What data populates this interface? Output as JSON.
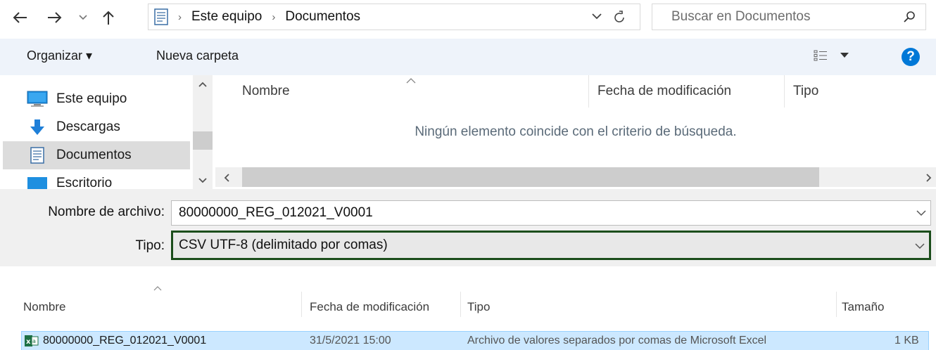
{
  "address_bar": {
    "breadcrumb": [
      "Este equipo",
      "Documentos"
    ],
    "search_placeholder": "Buscar en Documentos"
  },
  "command_bar": {
    "organize_label": "Organizar ▾",
    "new_folder_label": "Nueva carpeta",
    "help_label": "?"
  },
  "nav_pane": {
    "items": [
      {
        "label": "Este equipo",
        "icon": "computer-icon"
      },
      {
        "label": "Descargas",
        "icon": "download-arrow-icon"
      },
      {
        "label": "Documentos",
        "icon": "document-icon",
        "selected": true
      },
      {
        "label": "Escritorio",
        "icon": "desktop-folder-icon"
      }
    ]
  },
  "file_list": {
    "columns": [
      "Nombre",
      "Fecha de modificación",
      "Tipo"
    ],
    "empty_message": "Ningún elemento coincide con el criterio de búsqueda."
  },
  "form": {
    "filename_label": "Nombre de archivo:",
    "filename_value": "80000000_REG_012021_V0001",
    "type_label": "Tipo:",
    "type_value": "CSV UTF-8 (delimitado por comas)"
  },
  "explorer_list": {
    "columns": [
      "Nombre",
      "Fecha de modificación",
      "Tipo",
      "Tamaño"
    ],
    "rows": [
      {
        "name": "80000000_REG_012021_V0001",
        "date": "31/5/2021 15:00",
        "type": "Archivo de valores separados por comas de Microsoft Excel",
        "size": "1 KB",
        "icon": "excel-csv-icon"
      }
    ]
  },
  "colors": {
    "accent_blue": "#0078d7",
    "selection_row": "#cce8ff",
    "type_focus_border": "#1b4d1b"
  }
}
